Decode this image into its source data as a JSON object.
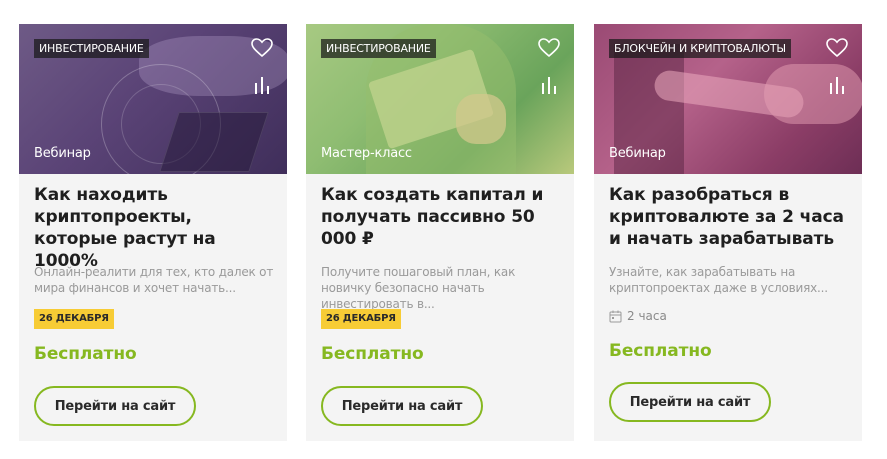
{
  "cards": [
    {
      "category": "ИНВЕСТИРОВАНИЕ",
      "format": "Вебинар",
      "title": "Как находить криптопроекты, которые растут на 1000%",
      "description": "Онлайн-реалити для тех, кто далек от мира финансов и хочет начать...",
      "date": "26 ДЕКАБРЯ",
      "price": "Бесплатно",
      "button": "Перейти на сайт"
    },
    {
      "category": "ИНВЕСТИРОВАНИЕ",
      "format": "Мастер-класс",
      "title": "Как создать капитал и получать пассивно 50 000 ₽",
      "description": "Получите пошаговый план, как новичку безопасно начать инвестировать в...",
      "date": "26 ДЕКАБРЯ",
      "price": "Бесплатно",
      "button": "Перейти на сайт"
    },
    {
      "category": "БЛОКЧЕЙН И КРИПТОВАЛЮТЫ",
      "format": "Вебинар",
      "title": "Как разобраться в криптовалюте за 2 часа и начать зарабатывать",
      "description": "Узнайте, как зарабатывать на криптопроектах даже в условиях...",
      "duration": "2 часа",
      "price": "Бесплатно",
      "button": "Перейти на сайт"
    }
  ],
  "colors": {
    "accent_green": "#86b820",
    "date_tag_yellow": "#f7cc35",
    "card_background": "#f4f4f4"
  },
  "icons": {
    "favorite": "heart-icon",
    "compare": "stats-icon",
    "duration": "calendar-icon"
  }
}
